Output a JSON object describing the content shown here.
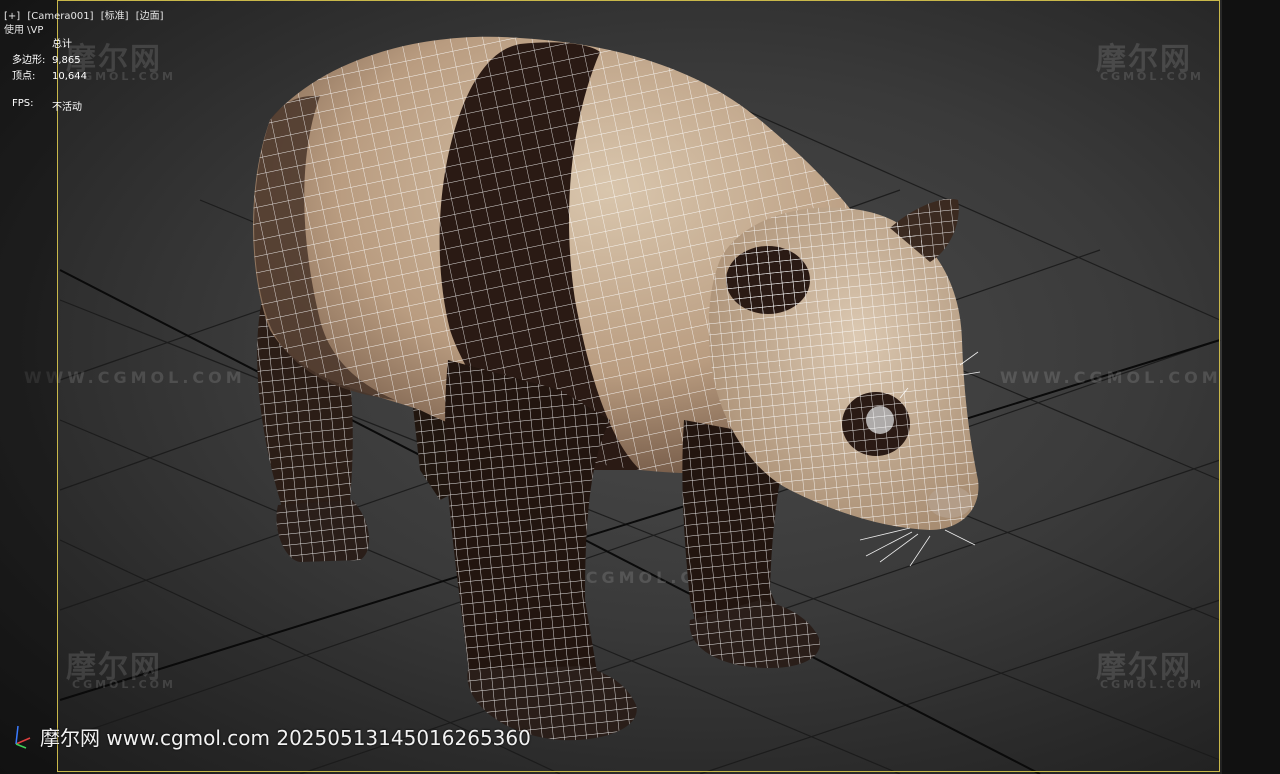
{
  "viewport": {
    "label_items": [
      "[+]",
      "[Camera001]",
      "[标准]",
      "[边面]"
    ],
    "mode": "使用 \\VP"
  },
  "stats": {
    "header": "总计",
    "polygons_label": "多边形:",
    "polygons_value": "9,865",
    "vertices_label": "顶点:",
    "vertices_value": "10,644",
    "fps_label": "FPS:",
    "fps_value": "不活动"
  },
  "watermarks": {
    "logo": "摩尔网",
    "sub": "CGMOL.COM",
    "line": "WWW.CGMOL.COM"
  },
  "footer_watermark": "摩尔网 www.cgmol.com 20250513145016265360",
  "colors": {
    "frame": "#c9b84a",
    "fur_light": "#c9b29a",
    "fur_dark": "#2a1c16",
    "wire": "#ffffff"
  },
  "icons": [
    "axis-tripod-icon"
  ]
}
